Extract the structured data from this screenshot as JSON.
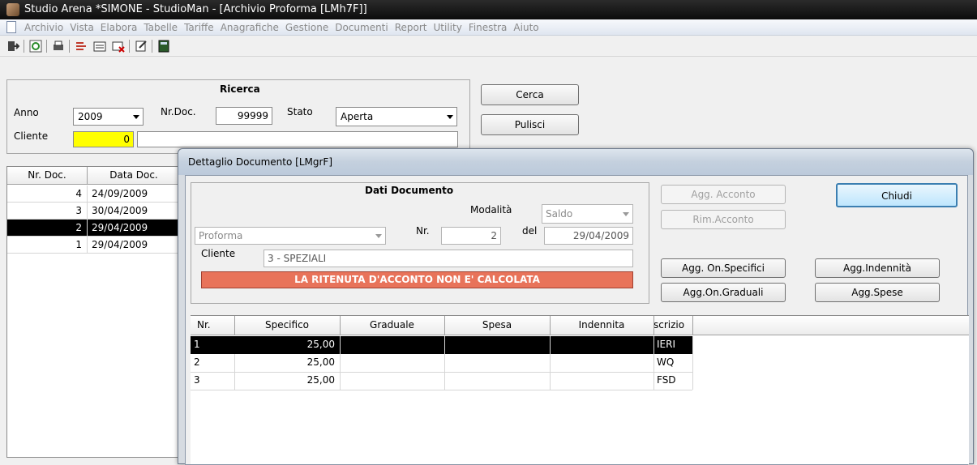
{
  "window": {
    "title": "Studio Arena *SIMONE - StudioMan - [Archivio Proforma  [LMh7F]]"
  },
  "menu": [
    "Archivio",
    "Vista",
    "Elabora",
    "Tabelle",
    "Tariffe",
    "Anagrafiche",
    "Gestione",
    "Documenti",
    "Report",
    "Utility",
    "Finestra",
    "Aiuto"
  ],
  "search": {
    "title": "Ricerca",
    "anno_label": "Anno",
    "anno_value": "2009",
    "nrdoc_label": "Nr.Doc.",
    "nrdoc_value": "99999",
    "stato_label": "Stato",
    "stato_value": "Aperta",
    "cliente_label": "Cliente",
    "cliente_code": "0",
    "cliente_name": "",
    "cerca": "Cerca",
    "pulisci": "Pulisci"
  },
  "list": {
    "headers": [
      "Nr. Doc.",
      "Data Doc."
    ],
    "rows": [
      {
        "nr": "4",
        "data": "24/09/2009"
      },
      {
        "nr": "3",
        "data": "30/04/2009"
      },
      {
        "nr": "2",
        "data": "29/04/2009"
      },
      {
        "nr": "1",
        "data": "29/04/2009"
      }
    ],
    "selected_index": 2
  },
  "dialog": {
    "title": "Dettaglio Documento  [LMgrF]",
    "dati_title": "Dati Documento",
    "modalita_label": "Modalità",
    "modalita_value": "Saldo",
    "tipo_value": "Proforma",
    "nr_label": "Nr.",
    "nr_value": "2",
    "del_label": "del",
    "del_value": "29/04/2009",
    "cliente_label": "Cliente",
    "cliente_value": "3 - SPEZIALI",
    "warning": "LA RITENUTA D'ACCONTO NON E' CALCOLATA",
    "buttons": {
      "agg_acconto": "Agg. Acconto",
      "rim_acconto": "Rim.Acconto",
      "chiudi": "Chiudi",
      "agg_on_specifici": "Agg. On.Specifici",
      "agg_indennita": "Agg.Indennità",
      "agg_on_graduali": "Agg.On.Graduali",
      "agg_spese": "Agg.Spese"
    },
    "grid": {
      "headers": [
        "Nr.",
        "Specifico",
        "Graduale",
        "Spesa",
        "Indennita",
        "scrizio"
      ],
      "rows": [
        {
          "nr": "1",
          "specifico": "25,00",
          "graduale": "",
          "spesa": "",
          "indennita": "",
          "descr": "IERI"
        },
        {
          "nr": "2",
          "specifico": "25,00",
          "graduale": "",
          "spesa": "",
          "indennita": "",
          "descr": "WQ"
        },
        {
          "nr": "3",
          "specifico": "25,00",
          "graduale": "",
          "spesa": "",
          "indennita": "",
          "descr": "FSD"
        }
      ],
      "selected_index": 0
    }
  },
  "colors": {
    "highlight_field": "#ffff00",
    "warning_bg": "#e8735a",
    "selected_row": "#000000"
  }
}
